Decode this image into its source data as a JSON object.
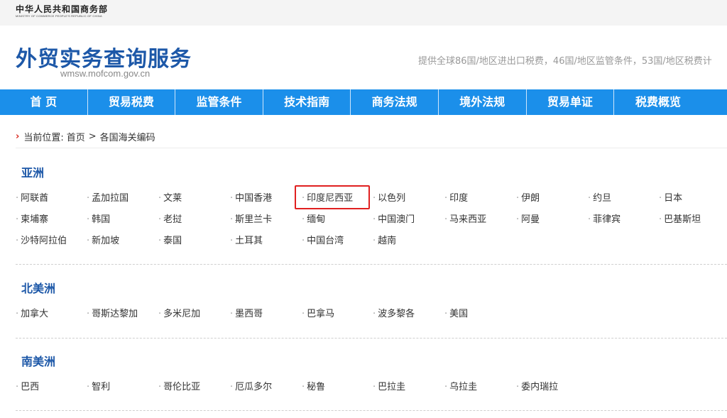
{
  "ministry": {
    "name_cn": "中华人民共和国商务部",
    "name_en": "MINISTRY OF COMMERCE PEOPLE'S REPUBLIC OF CHINA"
  },
  "header": {
    "title": "外贸实务查询服务",
    "domain": "wmsw.mofcom.gov.cn",
    "intro": "提供全球86国/地区进出口税费，46国/地区监管条件，53国/地区税费计"
  },
  "nav": {
    "items": [
      "首 页",
      "贸易税费",
      "监管条件",
      "技术指南",
      "商务法规",
      "境外法规",
      "贸易单证",
      "税费概览"
    ]
  },
  "breadcrumb": {
    "prefix": "当前位置:",
    "home": "首页",
    "separator": ">",
    "current": "各国海关编码"
  },
  "regions": [
    {
      "title": "亚洲",
      "countries": [
        "阿联酋",
        "孟加拉国",
        "文莱",
        "中国香港",
        "印度尼西亚",
        "以色列",
        "印度",
        "伊朗",
        "约旦",
        "日本",
        "柬埔寨",
        "韩国",
        "老挝",
        "斯里兰卡",
        "缅甸",
        "中国澳门",
        "马来西亚",
        "阿曼",
        "菲律宾",
        "巴基斯坦",
        "沙特阿拉伯",
        "新加坡",
        "泰国",
        "土耳其",
        "中国台湾",
        "越南"
      ],
      "highlighted": "印度尼西亚"
    },
    {
      "title": "北美洲",
      "countries": [
        "加拿大",
        "哥斯达黎加",
        "多米尼加",
        "墨西哥",
        "巴拿马",
        "波多黎各",
        "美国"
      ]
    },
    {
      "title": "南美洲",
      "countries": [
        "巴西",
        "智利",
        "哥伦比亚",
        "厄瓜多尔",
        "秘鲁",
        "巴拉圭",
        "乌拉圭",
        "委内瑞拉"
      ]
    }
  ],
  "colors": {
    "nav_bg": "#1b8fea",
    "title_blue": "#1d58a8",
    "highlight_border": "#e02020",
    "breadcrumb_arrow": "#d8261c"
  }
}
